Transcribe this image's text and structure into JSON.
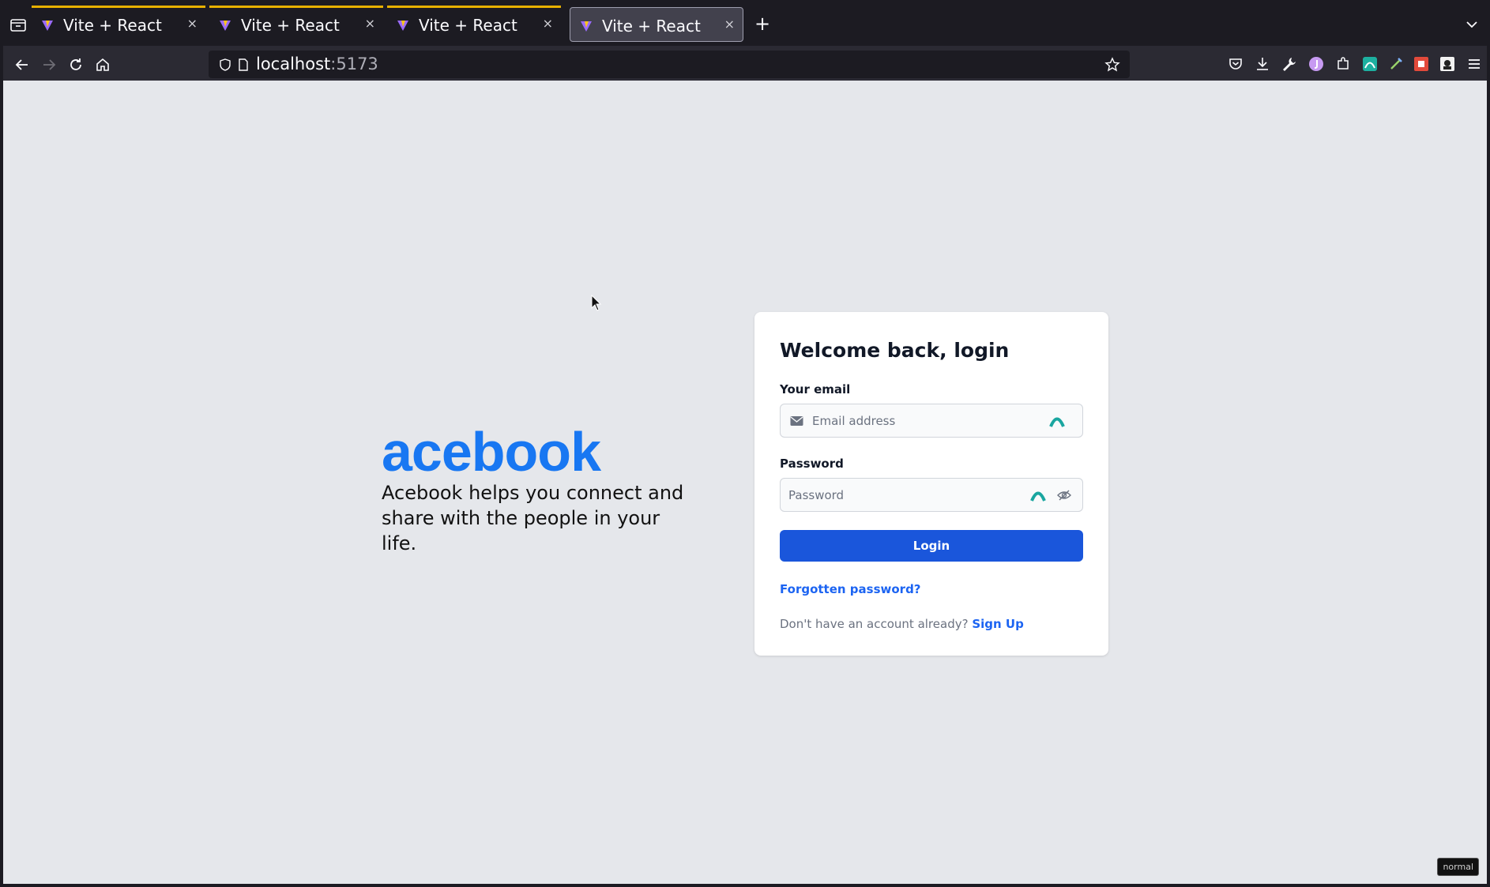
{
  "browser": {
    "tabs": [
      {
        "title": "Vite + React",
        "active": false
      },
      {
        "title": "Vite + React",
        "active": false
      },
      {
        "title": "Vite + React",
        "active": false
      },
      {
        "title": "Vite + React",
        "active": true
      }
    ],
    "tab_close_glyph": "×",
    "new_tab_glyph": "+",
    "url_host": "localhost",
    "url_port": ":5173",
    "accent_color": "#e7b000"
  },
  "page": {
    "brand_title": "acebook",
    "brand_tagline": "Acebook helps you connect and share with the people in your life.",
    "brand_color": "#1877f2",
    "login": {
      "heading": "Welcome back, login",
      "email_label": "Your email",
      "email_placeholder": "Email address",
      "password_label": "Password",
      "password_placeholder": "Password",
      "submit_label": "Login",
      "forgot_label": "Forgotten password?",
      "signup_prompt": "Don't have an account already?",
      "signup_label": "Sign Up",
      "button_color": "#1a56db"
    }
  },
  "status": {
    "mode": "normal"
  }
}
